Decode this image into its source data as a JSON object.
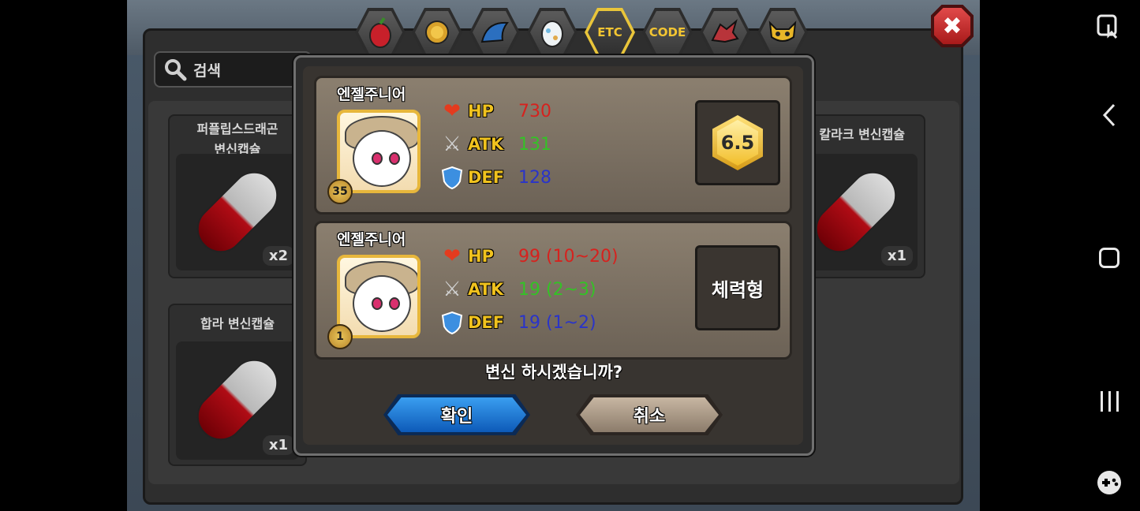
{
  "tabs": [
    {
      "icon": "fruit-icon",
      "label": ""
    },
    {
      "icon": "coin-icon",
      "label": ""
    },
    {
      "icon": "dragon-wing-icon",
      "label": ""
    },
    {
      "icon": "egg-icon",
      "label": ""
    },
    {
      "icon": "",
      "label": "ETC",
      "active": true
    },
    {
      "icon": "",
      "label": "CODE"
    },
    {
      "icon": "dragon-head-icon",
      "label": ""
    },
    {
      "icon": "mask-icon",
      "label": ""
    }
  ],
  "search": {
    "label": "검색"
  },
  "inventory": {
    "items": [
      {
        "name": "퍼플립스드래곤\n변신캡슐",
        "qty": "x2"
      },
      {
        "name": "칼라크 변신캡슐",
        "qty": "x1"
      },
      {
        "name": "합라 변신캡슐",
        "qty": "x1"
      }
    ]
  },
  "dialog": {
    "current": {
      "name": "엔젤주니어",
      "level": "35",
      "hp_label": "HP",
      "hp": "730",
      "atk_label": "ATK",
      "atk": "131",
      "def_label": "DEF",
      "def": "128",
      "grade": "6.5"
    },
    "target": {
      "name": "엔젤주니어",
      "level": "1",
      "hp_label": "HP",
      "hp": "99 (10~20)",
      "atk_label": "ATK",
      "atk": "19 (2~3)",
      "def_label": "DEF",
      "def": "19 (1~2)",
      "type": "체력형"
    },
    "question": "변신 하시겠습니까?",
    "confirm_label": "확인",
    "cancel_label": "취소"
  },
  "colors": {
    "hp": "#d6221e",
    "atk": "#34c226",
    "def": "#2a34c8",
    "accent": "#f0c21e"
  }
}
